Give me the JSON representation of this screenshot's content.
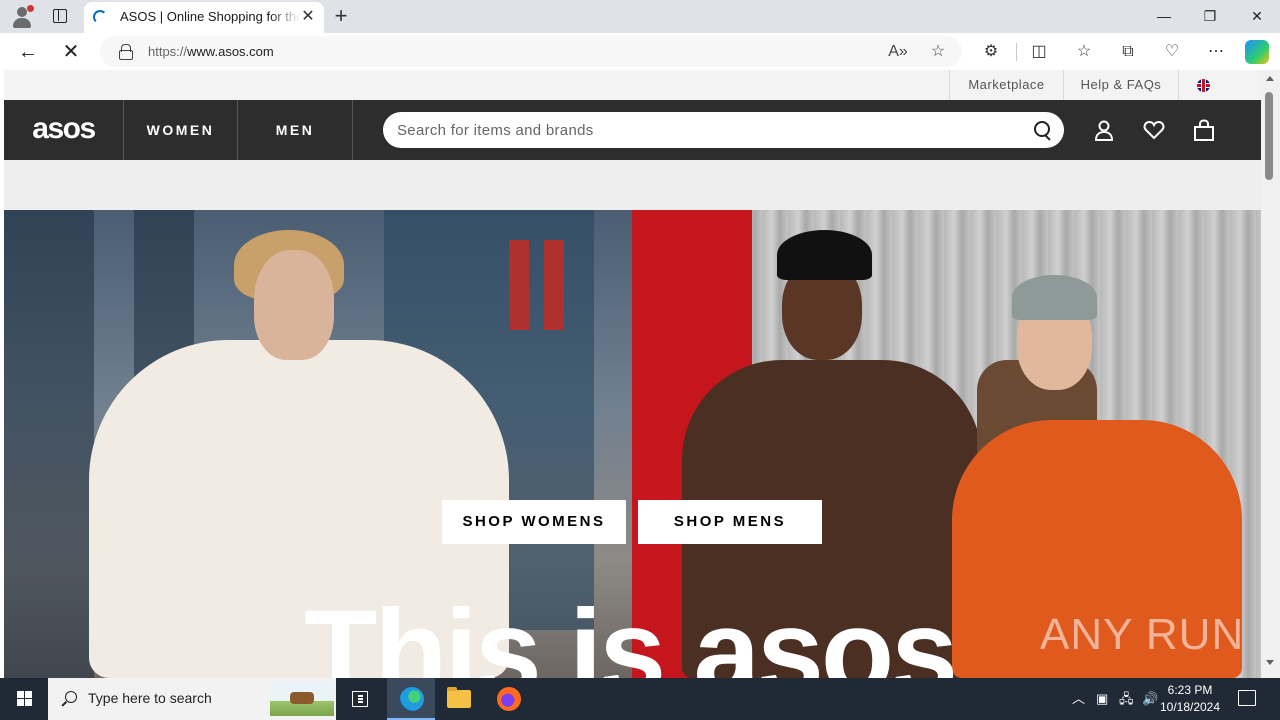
{
  "browser": {
    "tab_title": "ASOS | Online Shopping for the Latest Clothes & Fashion",
    "url_scheme": "https://",
    "url_host": "www.asos.com",
    "new_tab_icon": "plus-icon",
    "window_controls": [
      "minimize-icon",
      "restore-icon",
      "close-icon"
    ]
  },
  "asos": {
    "utility_links": [
      "Marketplace",
      "Help & FAQs"
    ],
    "logo_text": "asos",
    "nav": [
      "WOMEN",
      "MEN"
    ],
    "search_placeholder": "Search for items and brands",
    "hero": {
      "shop_women": "SHOP WOMENS",
      "shop_men": "SHOP MENS",
      "headline": "This is asos"
    }
  },
  "watermark": "ANY RUN",
  "taskbar": {
    "search_placeholder": "Type here to search",
    "time": "6:23 PM",
    "date": "10/18/2024"
  },
  "colors": {
    "nav_bg": "#2d2d2d",
    "taskbar_bg": "#1f2a36",
    "red_wall": "#c4161c",
    "orange_jacket": "#e05a1e"
  }
}
